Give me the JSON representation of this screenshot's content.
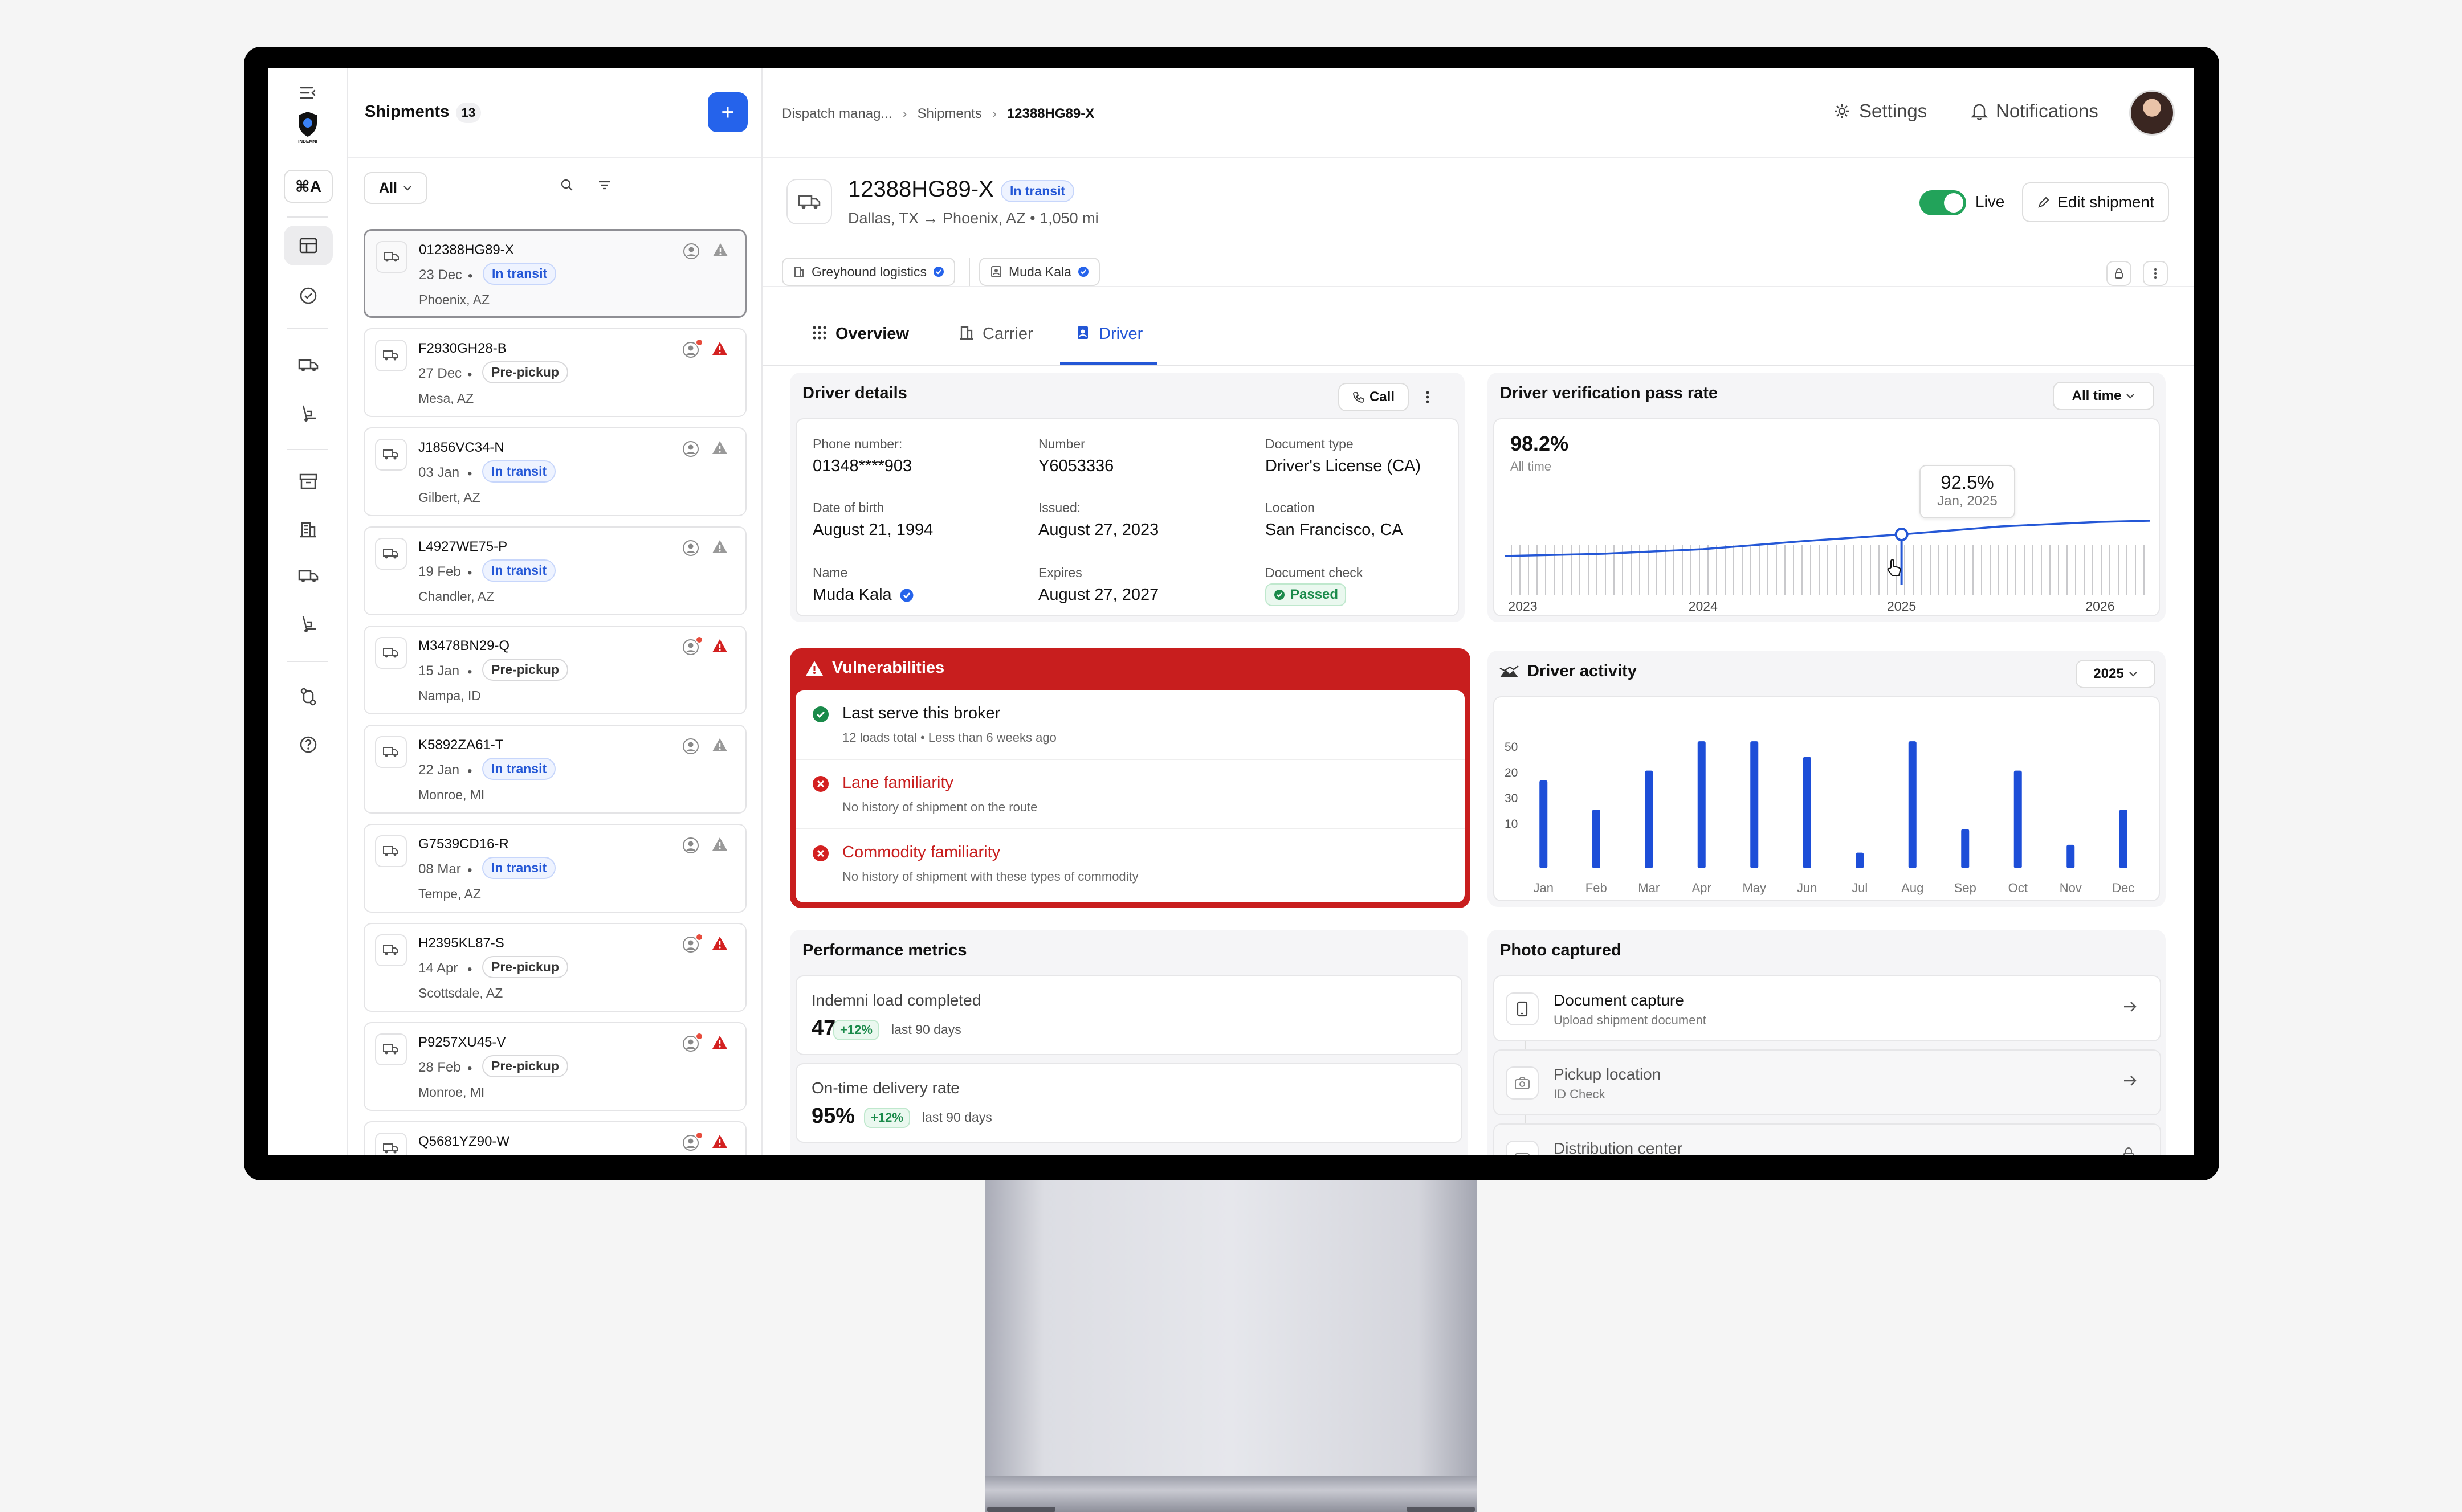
{
  "app": {
    "logo_text": "INDEMNI",
    "shortcut": "⌘A"
  },
  "shipments": {
    "title": "Shipments",
    "count": "13",
    "filter": "All",
    "items": [
      {
        "id": "012388HG89-X",
        "date": "23 Dec",
        "status": "In transit",
        "location": "Phoenix, AZ",
        "alert": false
      },
      {
        "id": "F2930GH28-B",
        "date": "27 Dec",
        "status": "Pre-pickup",
        "location": "Mesa, AZ",
        "alert": true
      },
      {
        "id": "J1856VC34-N",
        "date": "03 Jan",
        "status": "In transit",
        "location": "Gilbert, AZ",
        "alert": false
      },
      {
        "id": "L4927WE75-P",
        "date": "19 Feb",
        "status": "In transit",
        "location": "Chandler, AZ",
        "alert": false
      },
      {
        "id": "M3478BN29-Q",
        "date": "15 Jan",
        "status": "Pre-pickup",
        "location": "Nampa, ID",
        "alert": true
      },
      {
        "id": "K5892ZA61-T",
        "date": "22 Jan",
        "status": "In transit",
        "location": "Monroe, MI",
        "alert": false
      },
      {
        "id": "G7539CD16-R",
        "date": "08 Mar",
        "status": "In transit",
        "location": "Tempe, AZ",
        "alert": false
      },
      {
        "id": "H2395KL87-S",
        "date": "14 Apr",
        "status": "Pre-pickup",
        "location": "Scottsdale, AZ",
        "alert": true
      },
      {
        "id": "P9257XU45-V",
        "date": "28 Feb",
        "status": "Pre-pickup",
        "location": "Monroe, MI",
        "alert": true
      },
      {
        "id": "Q5681YZ90-W",
        "date": "",
        "status": "",
        "location": "",
        "alert": true
      }
    ]
  },
  "breadcrumb": {
    "items": [
      "Dispatch manag...",
      "Shipments"
    ],
    "current": "12388HG89-X"
  },
  "topbar": {
    "settings": "Settings",
    "notifications": "Notifications"
  },
  "shipment": {
    "id": "12388HG89-X",
    "status": "In transit",
    "route": "Dallas, TX → Phoenix, AZ • 1,050 mi",
    "live_label": "Live",
    "edit_label": "Edit shipment",
    "carrier_chip": "Greyhound logistics",
    "driver_chip": "Muda Kala"
  },
  "tabs": [
    "Overview",
    "Carrier",
    "Driver"
  ],
  "driver_details": {
    "title": "Driver details",
    "call_label": "Call",
    "fields": {
      "phone_label": "Phone number:",
      "phone": "01348****903",
      "number_label": "Number",
      "number": "Y6053336",
      "doctype_label": "Document type",
      "doctype": "Driver's License (CA)",
      "dob_label": "Date of birth",
      "dob": "August 21, 1994",
      "issued_label": "Issued:",
      "issued": "August 27, 2023",
      "location_label": "Location",
      "location": "San Francisco, CA",
      "name_label": "Name",
      "name": "Muda Kala",
      "expires_label": "Expires",
      "expires": "August 27, 2027",
      "doccheck_label": "Document check",
      "doccheck": "Passed"
    }
  },
  "verification": {
    "title": "Driver verification pass rate",
    "range": "All time",
    "value": "98.2%",
    "value_sub": "All time",
    "tooltip_value": "92.5%",
    "tooltip_date": "Jan, 2025"
  },
  "vulnerabilities": {
    "title": "Vulnerabilities",
    "items": [
      {
        "title": "Last serve this broker",
        "sub": "12 loads total • Less than 6 weeks ago",
        "ok": true
      },
      {
        "title": "Lane familiarity",
        "sub": "No history of shipment on the route",
        "ok": false
      },
      {
        "title": "Commodity familiarity",
        "sub": "No history of shipment with these types of commodity",
        "ok": false
      }
    ]
  },
  "activity": {
    "title": "Driver activity",
    "year": "2025"
  },
  "performance": {
    "title": "Performance metrics",
    "items": [
      {
        "label": "Indemni load completed",
        "value": "47",
        "delta": "+12%",
        "period": "last 90 days"
      },
      {
        "label": "On-time delivery rate",
        "value": "95%",
        "delta": "+12%",
        "period": "last 90 days"
      }
    ]
  },
  "photos": {
    "title": "Photo captured",
    "items": [
      {
        "title": "Document capture",
        "sub": "Upload shipment document"
      },
      {
        "title": "Pickup location",
        "sub": "ID Check"
      },
      {
        "title": "Distribution center",
        "sub": ""
      }
    ]
  },
  "chart_data": [
    {
      "type": "line",
      "title": "Driver verification pass rate",
      "x_ticks": [
        "2023",
        "2024",
        "2025",
        "2026"
      ],
      "xlim": [
        "2023-01",
        "2026-04"
      ],
      "series": [
        {
          "values": [
            {
              "x": "2023-01",
              "y": 90.6
            },
            {
              "x": "2023-07",
              "y": 90.8
            },
            {
              "x": "2024-01",
              "y": 91.2
            },
            {
              "x": "2024-07",
              "y": 91.9
            },
            {
              "x": "2025-01",
              "y": 92.5
            },
            {
              "x": "2025-07",
              "y": 93.2
            },
            {
              "x": "2026-01",
              "y": 93.6
            },
            {
              "x": "2026-04",
              "y": 93.7
            }
          ]
        }
      ],
      "highlight": {
        "x": "2025-01",
        "y": 92.5
      },
      "grid": false
    },
    {
      "type": "bar",
      "title": "Driver activity",
      "categories": [
        "Jan",
        "Feb",
        "Mar",
        "Apr",
        "May",
        "Jun",
        "Jul",
        "Aug",
        "Sep",
        "Oct",
        "Nov",
        "Dec"
      ],
      "y_ticks": [
        "50",
        "20",
        "30",
        "10"
      ],
      "values": [
        45,
        30,
        50,
        65,
        65,
        57,
        8,
        65,
        20,
        50,
        12,
        30
      ],
      "ylim": [
        0,
        70
      ],
      "color": "#1d4ed8"
    }
  ]
}
